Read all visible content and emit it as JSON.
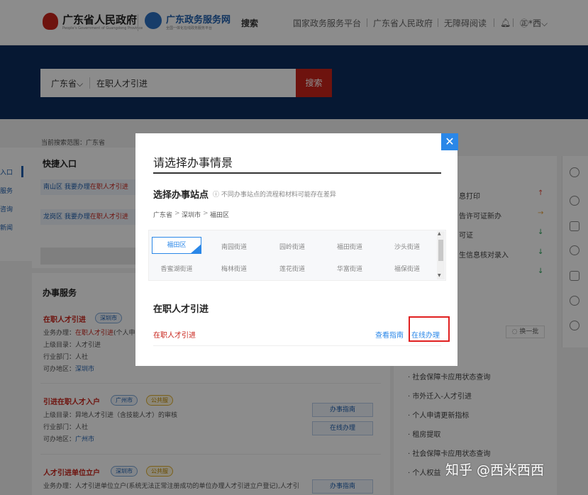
{
  "header": {
    "gov_name": "广东省人民政府",
    "gov_sub": "People's Government of Guangdong Province",
    "service_name": "广东政务服务网",
    "service_sub": "全国一体化在线政务服务平台",
    "search_label": "搜索",
    "links": [
      "国家政务服务平台",
      "广东省人民政府",
      "无障碍阅读"
    ],
    "user": "㊣*西",
    "user_caret": "⌵"
  },
  "search": {
    "region": "广东省",
    "region_caret": "⌵",
    "value": "在职人才引进",
    "button": "搜索"
  },
  "scope_text": "当前搜索范围：广东省",
  "left_nav": [
    "入口",
    "服务",
    "咨询",
    "新闻"
  ],
  "quick_entry": {
    "title": "快捷入口",
    "items": [
      {
        "district": "南山区",
        "prefix": "我要办理",
        "keyword": "在职人才引进"
      },
      {
        "district": "龙岗区",
        "prefix": "我要办理",
        "keyword": "在职人才引进"
      }
    ]
  },
  "services": {
    "title": "办事服务",
    "items": [
      {
        "title": "在职人才引进",
        "tags": [
          "深圳市"
        ],
        "lines": [
          "业务办理：在职人才引进(个人申",
          "上级目录：人才引进",
          "行业部门：人社",
          "可办地区：深圳市"
        ],
        "buttons": []
      },
      {
        "title": "引进在职人才入户",
        "tags": [
          "广州市",
          "公共服"
        ],
        "lines": [
          "上级目录：异地人才引进（含技能人才）的审核",
          "行业部门：人社",
          "可办地区：广州市"
        ],
        "buttons": [
          "办事指南",
          "在线办理"
        ]
      },
      {
        "title": "人才引进单位立户",
        "tags": [
          "深圳市",
          "公共服"
        ],
        "lines": [
          "业务办理：人才引进单位立户(系统无法正常注册成功的单位办理人才引进立户登记),人才引"
        ],
        "buttons": [
          "办事指南"
        ]
      }
    ]
  },
  "right_panel": {
    "hot_items": [
      {
        "text": "息打印",
        "arrow": "↑"
      },
      {
        "text": "告许可证新办",
        "arrow": "→"
      },
      {
        "text": "可证",
        "arrow": "↓"
      },
      {
        "text": "生信息核对录入",
        "arrow": "↓"
      },
      {
        "text": "",
        "arrow": "↓"
      }
    ],
    "refresh": "◌ 换一批",
    "links": [
      "社会保障卡应用状态查询",
      "市外迁入-人才引进",
      "个人申请更新指标",
      "租房提取",
      "社会保障卡应用状态查询",
      "个人权益"
    ]
  },
  "modal": {
    "close": "✕",
    "title": "请选择办事情景",
    "station_title": "选择办事站点",
    "hint": "ⓘ 不同办事站点的流程和材料可能存在差异",
    "breadcrumb": [
      "广东省",
      "深圳市",
      "福田区"
    ],
    "breadcrumb_sep": ">",
    "selected_street": "福田区",
    "check": "✓",
    "streets_row1": [
      "南园街道",
      "园岭街道",
      "福田街道",
      "沙头街道"
    ],
    "streets_row2": [
      "香蜜湖街道",
      "梅林街道",
      "莲花街道",
      "华富街道",
      "福保街道"
    ],
    "scroll_up": "▲",
    "scroll_down": "▼",
    "item_title": "在职人才引进",
    "item_name": "在职人才引进",
    "guide": "查看指南",
    "online": "在线办理"
  },
  "watermark": "知乎 @西米西西"
}
